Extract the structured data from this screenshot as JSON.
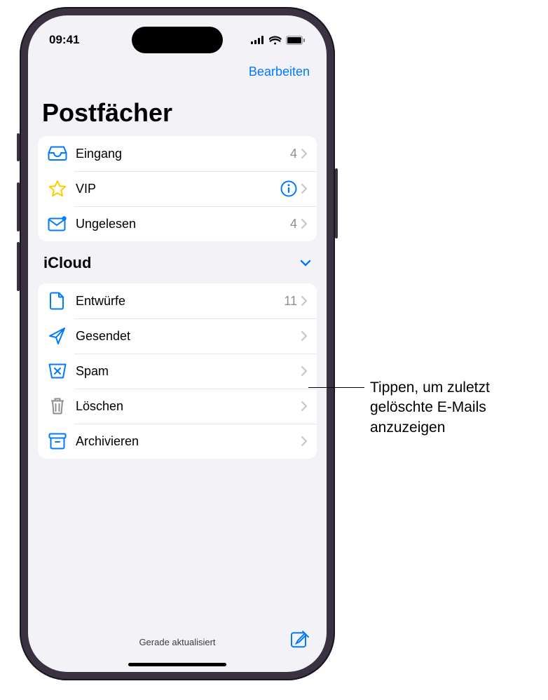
{
  "status": {
    "time": "09:41"
  },
  "nav": {
    "edit": "Bearbeiten"
  },
  "title": "Postfächer",
  "mailboxes": [
    {
      "icon": "inbox-icon",
      "label": "Eingang",
      "badge": "4",
      "info": false
    },
    {
      "icon": "star-icon",
      "label": "VIP",
      "badge": "",
      "info": true
    },
    {
      "icon": "unread-icon",
      "label": "Ungelesen",
      "badge": "4",
      "info": false
    }
  ],
  "section": {
    "title": "iCloud"
  },
  "icloud": [
    {
      "icon": "drafts-icon",
      "label": "Entwürfe",
      "badge": "11"
    },
    {
      "icon": "sent-icon",
      "label": "Gesendet",
      "badge": ""
    },
    {
      "icon": "spam-icon",
      "label": "Spam",
      "badge": ""
    },
    {
      "icon": "trash-icon",
      "label": "Löschen",
      "badge": ""
    },
    {
      "icon": "archive-icon",
      "label": "Archivieren",
      "badge": ""
    }
  ],
  "toolbar": {
    "status": "Gerade aktualisiert"
  },
  "callout": {
    "text": "Tippen, um zuletzt gelöschte E-Mails anzuzeigen"
  },
  "colors": {
    "accent": "#007aff",
    "star": "#ffcc00",
    "gray": "#8e8e93"
  }
}
